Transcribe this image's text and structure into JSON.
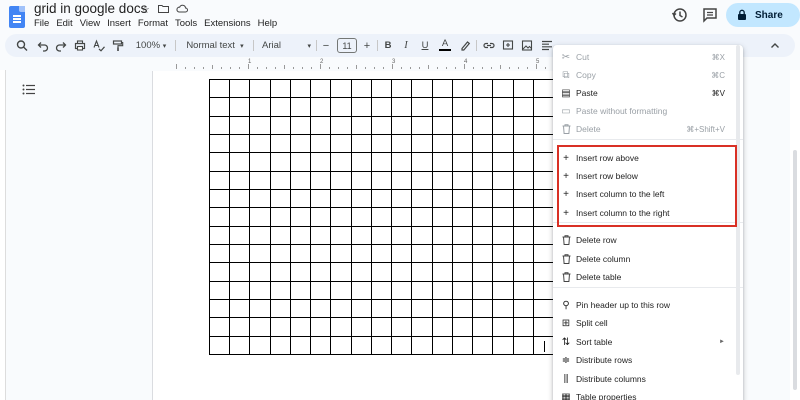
{
  "doc": {
    "title": "grid in google docs",
    "menus": [
      "File",
      "Edit",
      "View",
      "Insert",
      "Format",
      "Tools",
      "Extensions",
      "Help"
    ],
    "share_label": "Share"
  },
  "toolbar": {
    "zoom": "100%",
    "style": "Normal text",
    "font": "Arial",
    "font_size": "11",
    "minus": "−",
    "plus": "+",
    "bold": "B",
    "italic": "I",
    "underline": "U",
    "text_color": "A"
  },
  "ruler": {
    "numbers": [
      "1",
      "2",
      "3",
      "4",
      "5"
    ]
  },
  "context_menu": {
    "items": [
      {
        "label": "Cut",
        "shortcut": "⌘X",
        "icon": "scissors-icon",
        "disabled": true
      },
      {
        "label": "Copy",
        "shortcut": "⌘C",
        "icon": "copy-icon",
        "disabled": true
      },
      {
        "label": "Paste",
        "shortcut": "⌘V",
        "icon": "paste-icon",
        "disabled": false
      },
      {
        "label": "Paste without formatting",
        "shortcut": "",
        "icon": "paste-plain-icon",
        "disabled": true
      },
      {
        "label": "Delete",
        "shortcut": "⌘+Shift+V",
        "icon": "trash-icon",
        "disabled": true
      },
      {
        "label": "Insert row above",
        "shortcut": "",
        "icon": "plus-icon",
        "disabled": false
      },
      {
        "label": "Insert row below",
        "shortcut": "",
        "icon": "plus-icon",
        "disabled": false
      },
      {
        "label": "Insert column to the left",
        "shortcut": "",
        "icon": "plus-icon",
        "disabled": false
      },
      {
        "label": "Insert column to the right",
        "shortcut": "",
        "icon": "plus-icon",
        "disabled": false
      },
      {
        "label": "Delete row",
        "shortcut": "",
        "icon": "trash-icon",
        "disabled": false
      },
      {
        "label": "Delete column",
        "shortcut": "",
        "icon": "trash-icon",
        "disabled": false
      },
      {
        "label": "Delete table",
        "shortcut": "",
        "icon": "trash-icon",
        "disabled": false
      },
      {
        "label": "Pin header up to this row",
        "shortcut": "",
        "icon": "pin-icon",
        "disabled": false
      },
      {
        "label": "Split cell",
        "shortcut": "",
        "icon": "split-cell-icon",
        "disabled": false
      },
      {
        "label": "Sort table",
        "shortcut": "",
        "icon": "sort-icon",
        "disabled": false,
        "submenu": true
      },
      {
        "label": "Distribute rows",
        "shortcut": "",
        "icon": "distribute-rows-icon",
        "disabled": false
      },
      {
        "label": "Distribute columns",
        "shortcut": "",
        "icon": "distribute-columns-icon",
        "disabled": false
      },
      {
        "label": "Table properties",
        "shortcut": "",
        "icon": "table-properties-icon",
        "disabled": false
      }
    ]
  },
  "colors": {
    "accent": "#c2e7ff",
    "highlight": "#d93025",
    "toolbar_bg": "#edf2fa"
  }
}
